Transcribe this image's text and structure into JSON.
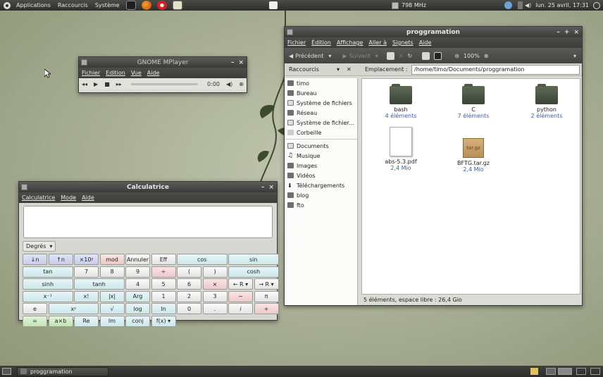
{
  "top_panel": {
    "menus": [
      "Applications",
      "Raccourcis",
      "Système"
    ],
    "launchers": [
      "terminal-launcher",
      "firefox-launcher",
      "opera-launcher",
      "app-launcher"
    ],
    "cpu_freq": "798 MHz",
    "clock": "lun. 25 avril, 17:31"
  },
  "mplayer": {
    "title": "GNOME MPlayer",
    "menu": [
      "Fichier",
      "Edition",
      "Vue",
      "Aide"
    ],
    "time": "0:00"
  },
  "file_manager": {
    "title": "proggramation",
    "menu": [
      "Fichier",
      "Édition",
      "Affichage",
      "Aller à",
      "Signets",
      "Aide"
    ],
    "toolbar": {
      "back": "Précédent",
      "forward": "Suivant",
      "zoom": "100%"
    },
    "sidebar_header": "Raccourcis",
    "location_label": "Emplacement :",
    "location": "/home/timo/Documents/proggramation",
    "places": [
      "timo",
      "Bureau",
      "Système de fichiers",
      "Réseau",
      "Système de fichier...",
      "Corbeille"
    ],
    "bookmarks": [
      "Documents",
      "Musique",
      "Images",
      "Vidéos",
      "Téléchargements",
      "blog",
      "fto"
    ],
    "files": [
      {
        "name": "bash",
        "info": "4 éléments",
        "kind": "folder"
      },
      {
        "name": "C",
        "info": "7 éléments",
        "kind": "folder"
      },
      {
        "name": "python",
        "info": "2 éléments",
        "kind": "folder"
      },
      {
        "name": "abs-5.3.pdf",
        "info": "2,4 Mio",
        "kind": "pdf"
      },
      {
        "name": "BFTG.tar.gz",
        "info": "2,4 Mio",
        "kind": "archive"
      }
    ],
    "tgz_label": "tar.gz",
    "status": "5 éléments, espace libre : 26,4 Gio"
  },
  "calculator": {
    "title": "Calculatrice",
    "menu": [
      "Calculatrice",
      "Mode",
      "Aide"
    ],
    "angle_unit": "Degrés",
    "keys": [
      [
        "↓n",
        "↑n",
        "×10ʸ",
        "mod",
        "Annuler",
        "Eff",
        "cos",
        "sin",
        "tan"
      ],
      [
        "7",
        "8",
        "9",
        "÷",
        "(",
        ")",
        "cosh",
        "sinh",
        "tanh"
      ],
      [
        "4",
        "5",
        "6",
        "×",
        "← R ▾",
        "→ R ▾",
        "x⁻¹",
        "x!",
        "|x|",
        "Arg"
      ],
      [
        "1",
        "2",
        "3",
        "−",
        "π",
        "e",
        "xʸ",
        "√",
        "log",
        "ln"
      ],
      [
        "0",
        ".",
        "i",
        "+",
        "=",
        "a×b",
        "Re",
        "Im",
        "conj",
        "f(x) ▾"
      ]
    ]
  },
  "bottom_panel": {
    "task": "proggramation"
  }
}
